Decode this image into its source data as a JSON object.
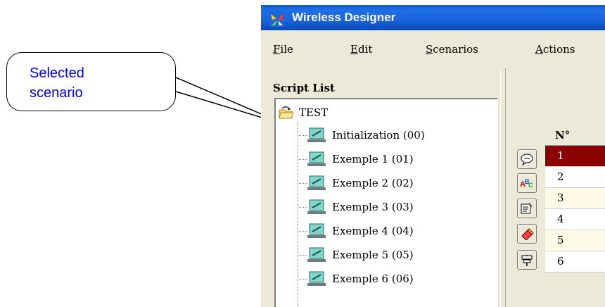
{
  "callout": {
    "text_line1": "Selected",
    "text_line2": "scenario"
  },
  "window": {
    "title": "Wireless Designer"
  },
  "menu": {
    "file": {
      "first": "F",
      "rest": "ile"
    },
    "edit": {
      "first": "E",
      "rest": "dit"
    },
    "scenarios": {
      "first": "S",
      "rest": "cenarios"
    },
    "actions": {
      "first": "A",
      "rest": "ctions"
    }
  },
  "script_list": {
    "label": "Script List",
    "root": "TEST",
    "items": [
      "Initialization (00)",
      "Exemple 1 (01)",
      "Exemple 2 (02)",
      "Exemple 3 (03)",
      "Exemple 4 (04)",
      "Exemple 5 (05)",
      "Exemple 6 (06)"
    ]
  },
  "toolbar": {
    "icons": [
      "speech-bubble-icon",
      "spell-check-icon",
      "properties-icon",
      "eraser-icon",
      "signpost-icon"
    ]
  },
  "grid": {
    "header": "N°",
    "rows": [
      "1",
      "2",
      "3",
      "4",
      "5",
      "6"
    ],
    "selected_row": "1"
  },
  "colors": {
    "callout_text": "#0000ff",
    "title_bar": "#1f6fe8",
    "selected_row": "#8b0000",
    "row_even": "#ffffff",
    "row_odd": "#fffbe6"
  }
}
